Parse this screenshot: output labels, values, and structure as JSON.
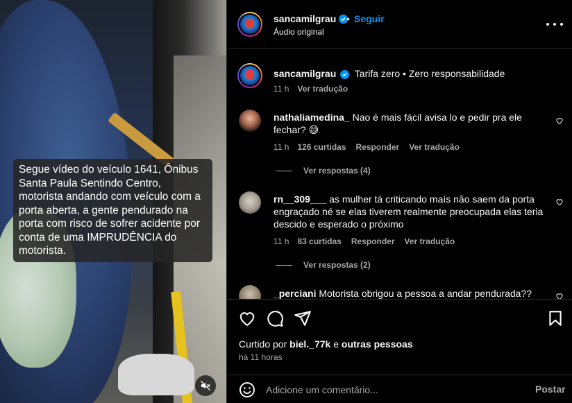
{
  "video": {
    "caption": "Segue vídeo do veículo 1641, Ônibus Santa Paula Sentindo Centro, motorista andando com veículo com a porta aberta, a gente pendurado na porta com risco de sofrer acidente por conta de uma IMPRUDÊNCIA do motorista.",
    "mute_icon": "speaker-muted-icon"
  },
  "header": {
    "username": "sancamilgrau",
    "separator": "•",
    "follow_label": "Seguir",
    "subtitle": "Áudio original",
    "more_icon": "more-horizontal-icon"
  },
  "caption_comment": {
    "username": "sancamilgrau",
    "text": "Tarifa zero • Zero responsabilidade",
    "time": "11 h",
    "translate": "Ver tradução"
  },
  "comments": [
    {
      "username": "nathaliamedina_",
      "text": "Nao é mais fácil avisa lo e pedir pra ele fechar? 😅",
      "time": "11 h",
      "likes": "126 curtidas",
      "reply": "Responder",
      "translate": "Ver tradução",
      "view_replies": "Ver respostas (4)"
    },
    {
      "username": "rn__309___",
      "text": "as mulher tá criticando maís não saem da porta engraçado né se elas tiverem realmente preocupada elas teria descido e esperado o próximo",
      "time": "11 h",
      "likes": "83 curtidas",
      "reply": "Responder",
      "translate": "Ver tradução",
      "view_replies": "Ver respostas (2)"
    },
    {
      "username": "_perciani",
      "text": "Motorista obrigou a pessoa a andar pendurada??"
    }
  ],
  "actions": {
    "liked_prefix": "Curtido por",
    "liked_user": "biel._77k",
    "liked_joiner": "e",
    "liked_others": "outras pessoas",
    "time_ago": "há 11 horas"
  },
  "composer": {
    "placeholder": "Adicione um comentário...",
    "post_label": "Postar"
  },
  "colors": {
    "accent": "#0095f6",
    "muted_text": "#a8a8a8",
    "background": "#000000"
  }
}
